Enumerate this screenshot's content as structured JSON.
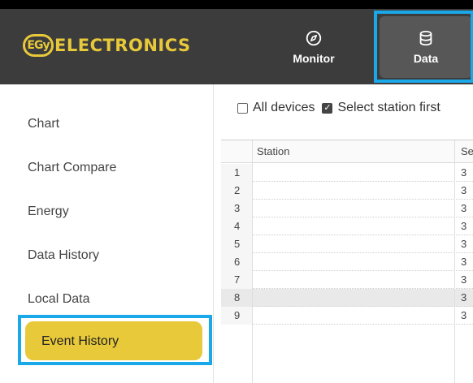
{
  "header": {
    "logo_badge": "EGy",
    "logo_text": "ELECTRONICS",
    "nav": [
      {
        "label": "Monitor",
        "icon": "compass-icon"
      },
      {
        "label": "Data",
        "icon": "database-icon"
      }
    ]
  },
  "sidebar": {
    "items": [
      {
        "label": "Chart"
      },
      {
        "label": "Chart Compare"
      },
      {
        "label": "Energy"
      },
      {
        "label": "Data History"
      },
      {
        "label": "Local Data"
      },
      {
        "label": "Event History"
      }
    ],
    "active": "Event History"
  },
  "filters": {
    "all_devices": {
      "label": "All devices",
      "checked": false
    },
    "select_station": {
      "label": "Select station first",
      "checked": true
    }
  },
  "table": {
    "columns": [
      "Station",
      "Se"
    ],
    "rows": [
      {
        "num": "1",
        "station": "",
        "serial": "3"
      },
      {
        "num": "2",
        "station": "",
        "serial": "3"
      },
      {
        "num": "3",
        "station": "",
        "serial": "3"
      },
      {
        "num": "4",
        "station": "",
        "serial": "3"
      },
      {
        "num": "5",
        "station": "",
        "serial": "3"
      },
      {
        "num": "6",
        "station": "",
        "serial": "3"
      },
      {
        "num": "7",
        "station": "",
        "serial": "3"
      },
      {
        "num": "8",
        "station": "",
        "serial": "3"
      },
      {
        "num": "9",
        "station": "",
        "serial": "3"
      }
    ],
    "selected_row": "8"
  },
  "colors": {
    "accent": "#e8c93a",
    "header_bg": "#3c3c3c",
    "highlight": "#1aa8e8"
  }
}
